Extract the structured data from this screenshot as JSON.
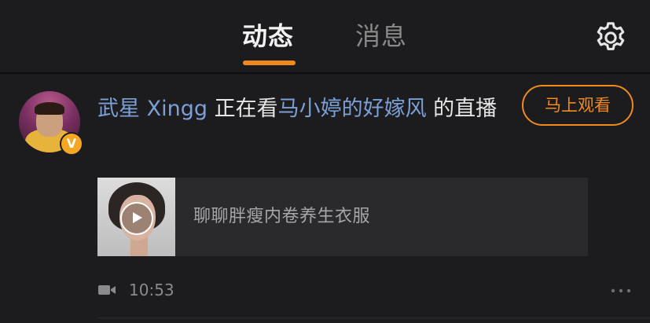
{
  "header": {
    "tabs": [
      {
        "label": "动态",
        "active": true
      },
      {
        "label": "消息",
        "active": false
      }
    ],
    "settings_icon": "gear-icon",
    "accent_color": "#f08a1f"
  },
  "feed": {
    "item": {
      "avatar": {
        "verified_badge": "V"
      },
      "user_name": "武星 Xingg",
      "action_text": "正在看",
      "target_name": "马小婷的好嫁风",
      "suffix_text": "的直播",
      "watch_button": "马上观看",
      "card": {
        "title": "聊聊胖瘦内卷养生衣服",
        "play_icon": "play-icon"
      },
      "time": "10:53",
      "type_icon": "video-camera-icon",
      "more_icon": "more-icon"
    }
  }
}
